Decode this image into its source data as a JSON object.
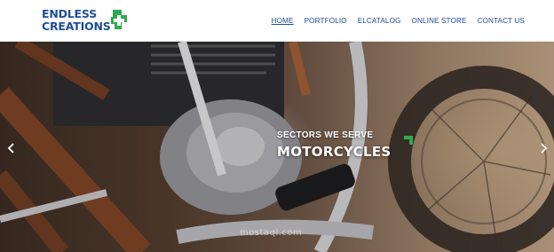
{
  "header": {
    "logo": {
      "line1": "ENDLESS",
      "line2": "CREATIONS"
    },
    "nav": [
      {
        "label": "HOME",
        "active": true
      },
      {
        "label": "PORTFOLIO",
        "active": false
      },
      {
        "label": "ELCATALOG",
        "active": false
      },
      {
        "label": "ONLINE STORE",
        "active": false
      },
      {
        "label": "CONTACT US",
        "active": false
      }
    ]
  },
  "hero": {
    "subtitle": "SECTORS WE SERVE",
    "title": "MOTORCYCLES",
    "prev_icon": "chevron-left-icon",
    "next_icon": "chevron-right-icon",
    "watermark": "mostaql.com"
  },
  "colors": {
    "brand_blue": "#1f4e96",
    "brand_green": "#2fa94e"
  }
}
